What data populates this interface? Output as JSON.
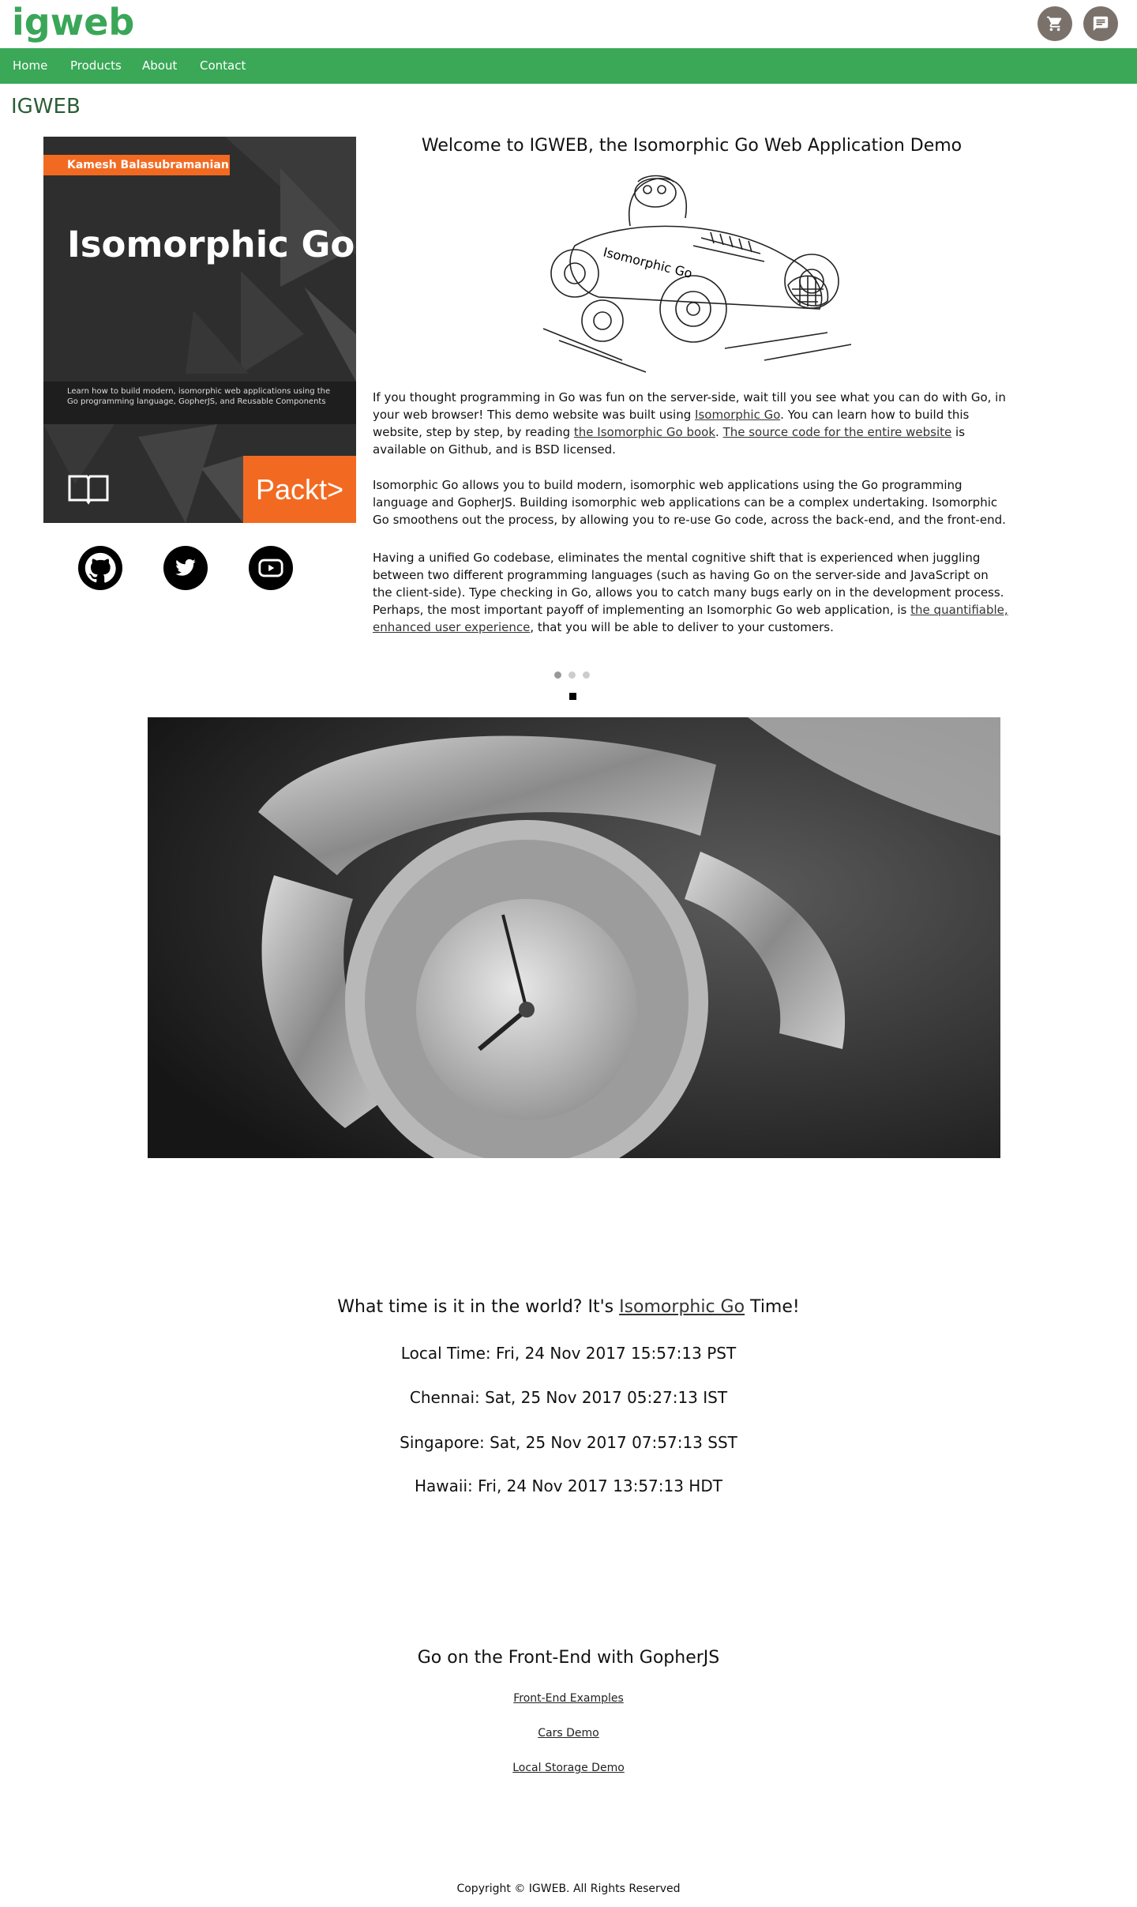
{
  "header": {
    "logo": "igweb",
    "cart_icon": "shopping-cart-icon",
    "chat_icon": "chat-bubble-icon"
  },
  "nav": {
    "items": [
      {
        "label": "Home"
      },
      {
        "label": "Products"
      },
      {
        "label": "About"
      },
      {
        "label": "Contact"
      }
    ]
  },
  "colors": {
    "brand_green": "#3aa857",
    "heading_green": "#2b5d35",
    "packt_orange": "#f26a21",
    "icon_grey": "#7b716b"
  },
  "main": {
    "heading": "IGWEB",
    "book": {
      "author": "Kamesh Balasubramanian",
      "title": "Isomorphic Go",
      "blurb": "Learn how to build modern, isomorphic web applications using the Go programming language, GopherJS, and Reusable Components",
      "publisher": "Packt>"
    },
    "social": [
      {
        "icon": "github-icon"
      },
      {
        "icon": "twitter-icon"
      },
      {
        "icon": "youtube-icon"
      }
    ],
    "welcome_title": "Welcome to IGWEB, the Isomorphic Go Web Application Demo",
    "car_label": "Isomorphic Go",
    "p1": {
      "t1": "If you thought programming in Go was fun on the server-side, wait till you see what you can do with Go, in your web browser! This demo website was built using ",
      "l1": "Isomorphic Go",
      "t2": ". You can learn how to build this website, step by step, by reading ",
      "l2": "the Isomorphic Go book",
      "t3": ". ",
      "l3": "The source code for the entire website",
      "t4": " is available on Github, and is BSD licensed."
    },
    "p2": "Isomorphic Go allows you to build modern, isomorphic web applications using the Go programming language and GopherJS. Building isomorphic web applications can be a complex undertaking. Isomorphic Go smoothens out the process, by allowing you to re-use Go code, across the back-end, and the front-end.",
    "p3": {
      "t1": "Having a unified Go codebase, eliminates the mental cognitive shift that is experienced when juggling between two different programming languages (such as having Go on the server-side and JavaScript on the client-side). Type checking in Go, allows you to catch many bugs early on in the development process. Perhaps, the most important payoff of implementing an Isomorphic Go web application, is ",
      "l1": "the quantifiable, enhanced user experience",
      "t2": ", that you will be able to deliver to your customers."
    },
    "carousel": {
      "slides": 3,
      "active": 1
    }
  },
  "time": {
    "title_pre": "What time is it in the world? It's ",
    "title_link": "Isomorphic Go",
    "title_post": " Time!",
    "rows": [
      "Local Time: Fri, 24 Nov 2017 15:57:13 PST",
      "Chennai: Sat, 25 Nov 2017 05:27:13 IST",
      "Singapore: Sat, 25 Nov 2017 07:57:13 SST",
      "Hawaii: Fri, 24 Nov 2017 13:57:13 HDT"
    ]
  },
  "frontend": {
    "title": "Go on the Front-End with GopherJS",
    "links": [
      "Front-End Examples",
      "Cars Demo",
      "Local Storage Demo"
    ]
  },
  "footer": {
    "copyright": "Copyright © IGWEB. All Rights Reserved"
  }
}
